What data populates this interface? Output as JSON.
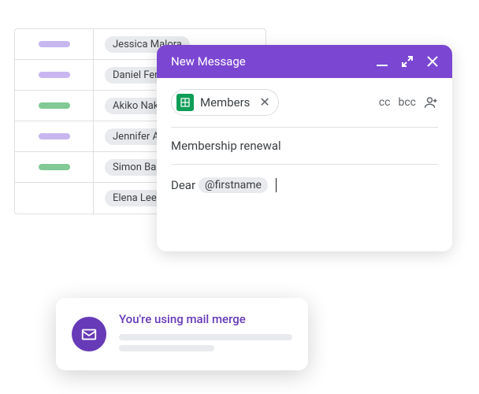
{
  "table": {
    "rows": [
      {
        "pill_color": "purple",
        "name": "Jessica Malora"
      },
      {
        "pill_color": "purple",
        "name": "Daniel Ferr"
      },
      {
        "pill_color": "green",
        "name": "Akiko Naka"
      },
      {
        "pill_color": "purple",
        "name": "Jennifer Ac"
      },
      {
        "pill_color": "green",
        "name": "Simon Balli"
      },
      {
        "pill_color": "",
        "name": "Elena Lee"
      }
    ]
  },
  "compose": {
    "title": "New Message",
    "recipient_chip": "Members",
    "cc_label": "cc",
    "bcc_label": "bcc",
    "subject": "Membership renewal",
    "body_greeting": "Dear",
    "merge_field": "@firstname"
  },
  "toast": {
    "title": "You're using mail merge"
  },
  "colors": {
    "brand_purple": "#7b46d1",
    "accent_purple": "#673ab7",
    "pill_purple": "#c8b6f0",
    "pill_green": "#81c995",
    "sheets_green": "#0f9d58"
  }
}
